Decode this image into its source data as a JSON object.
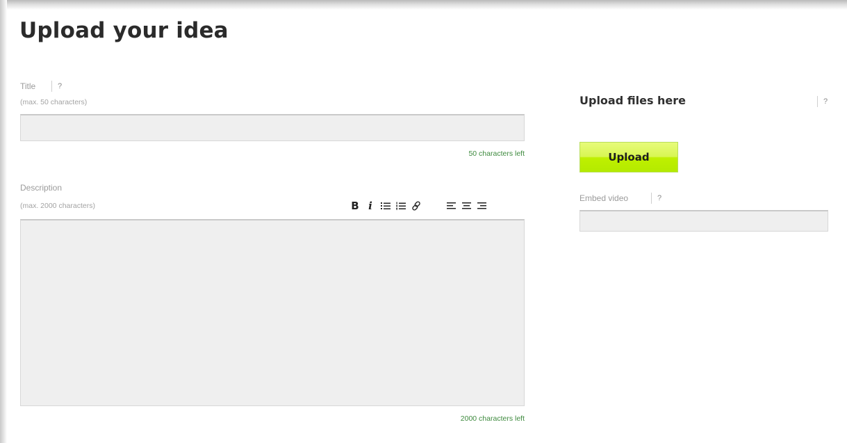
{
  "page": {
    "title": "Upload your idea"
  },
  "title_field": {
    "label": "Title",
    "help": "?",
    "hint": "(max. 50 characters)",
    "value": "",
    "counter": "50 characters left"
  },
  "description_field": {
    "label": "Description",
    "hint": "(max. 2000 characters)",
    "value": "",
    "counter": "2000 characters left",
    "toolbar": {
      "bold": "B",
      "italic": "i",
      "icons": [
        "bullet-list-icon",
        "numbered-list-icon",
        "link-icon",
        "align-left-icon",
        "align-center-icon",
        "align-right-icon"
      ]
    }
  },
  "upload_section": {
    "heading": "Upload files here",
    "help": "?",
    "button_label": "Upload"
  },
  "embed_video": {
    "label": "Embed video",
    "help": "?",
    "value": ""
  },
  "colors": {
    "upload_button": "#c4f20f",
    "counter_text": "#3e8a3e",
    "input_bg": "#efefef"
  }
}
